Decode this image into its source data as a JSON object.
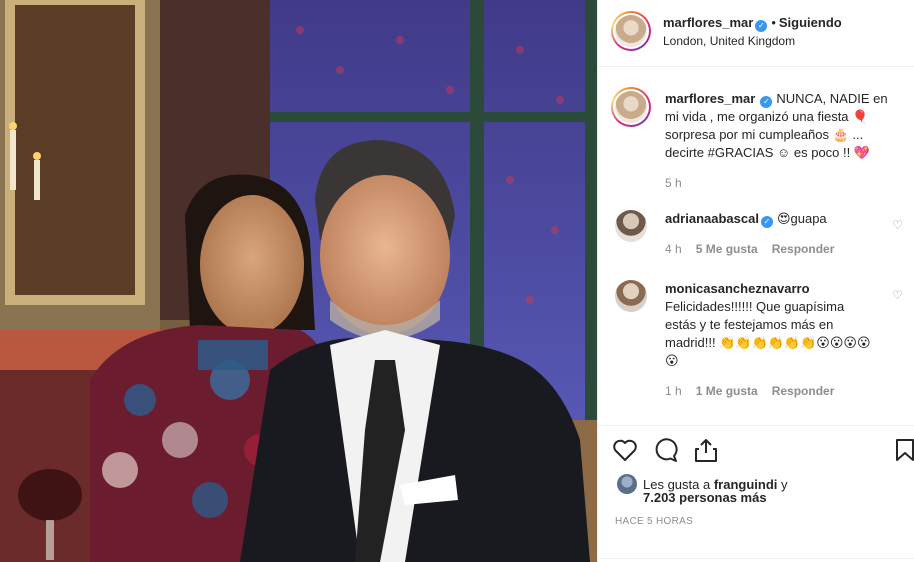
{
  "post": {
    "username": "marflores_mar",
    "follow_separator": "•",
    "follow_status": "Siguiendo",
    "location": "London, United Kingdom"
  },
  "caption": {
    "username": "marflores_mar",
    "text": "NUNCA, NADIE en mi vida , me organizó una fiesta 🎈 sorpresa por mi cumpleaños 🎂 ... decirte #GRACIAS ☺ es poco !! 💖",
    "time": "5 h"
  },
  "comments": [
    {
      "username": "adrianaabascal",
      "verified": true,
      "text": "😍guapa",
      "time": "4 h",
      "likes": "5 Me gusta",
      "reply": "Responder"
    },
    {
      "username": "monicasancheznavarro",
      "verified": false,
      "text": "Felicidades!!!!!! Que guapísima estás y te festejamos más en madrid!!! 👏👏👏👏👏👏😮😮😮😮😮",
      "time": "1 h",
      "likes": "1 Me gusta",
      "reply": "Responder"
    }
  ],
  "likes": {
    "prefix": "Les gusta a",
    "first_user": "franguindi",
    "connector": "y",
    "others": "7.203 personas más"
  },
  "timestamp": "HACE 5 HORAS",
  "icons": [
    "like-icon",
    "comment-icon",
    "share-icon",
    "save-icon",
    "verified-badge-icon",
    "comment-like-icon"
  ],
  "colors": {
    "verified": "#3897f0",
    "meta_text": "#8e8e8e",
    "primary_text": "#262626",
    "divider": "#efefef"
  }
}
